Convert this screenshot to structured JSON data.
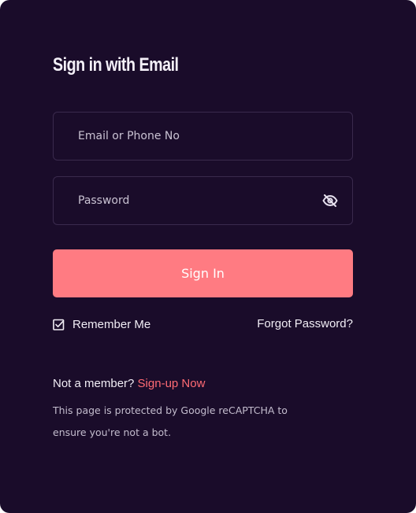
{
  "form": {
    "title": "Sign in with Email",
    "email_placeholder": "Email or Phone No",
    "email_value": "",
    "password_placeholder": "Password",
    "password_value": "",
    "visibility_icon": "eye-off-icon",
    "submit_label": "Sign In",
    "remember_label": "Remember Me",
    "remember_checked": true,
    "forgot_label": "Forgot Password?"
  },
  "signup": {
    "prompt": "Not a member?",
    "link_label": "Sign-up Now"
  },
  "recaptcha_note": "This page is protected by Google reCAPTCHA to ensure you're not a bot.",
  "colors": {
    "background": "#1a0c2a",
    "accent": "#ff7b82",
    "link": "#ff6b74",
    "field_border": "#3a2a4d"
  }
}
